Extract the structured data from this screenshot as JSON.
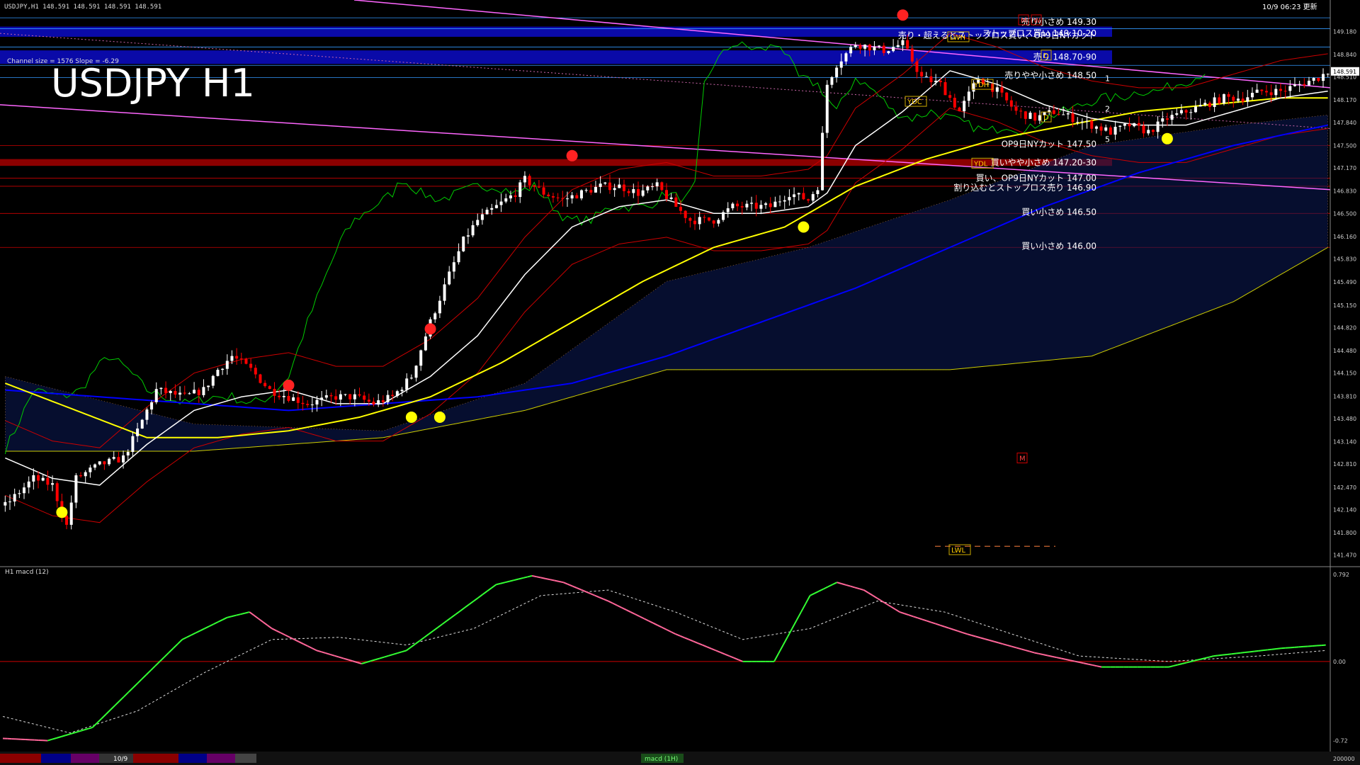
{
  "header": {
    "symbol_line": "USDJPY,H1  148.591 148.591 148.591 148.591",
    "channel_info": "Channel size = 1576 Slope = -6.29",
    "big_title": "USDJPY H1",
    "datetime": "10/9 06:23 更新"
  },
  "price_axis": {
    "labels": [
      "149.180",
      "148.840",
      "148.510",
      "148.170",
      "147.840",
      "147.500",
      "147.170",
      "146.830",
      "146.500",
      "146.160",
      "145.830",
      "145.490",
      "145.150",
      "144.820",
      "144.480",
      "144.150",
      "143.810",
      "143.480",
      "143.140",
      "142.810",
      "142.470",
      "142.140",
      "141.800",
      "141.470"
    ],
    "current": "148.591"
  },
  "annotations": [
    {
      "text": "売り小さめ 149.30",
      "price": 149.32,
      "color": "#ffffff"
    },
    {
      "text": "ストップロス買い 149.10-20",
      "price": 149.15,
      "color": "#ffffff"
    },
    {
      "text": "売り・超えるとストップロス買い、OP9日NYカット",
      "price": 149.12,
      "color": "#ffffff"
    },
    {
      "text": "売り 148.70-90",
      "price": 148.8,
      "color": "#ffffff"
    },
    {
      "text": "売りやや小さめ 148.50",
      "price": 148.53,
      "color": "#ffffff"
    },
    {
      "text": "OP9日NYカット 147.50",
      "price": 147.52,
      "color": "#ffffff"
    },
    {
      "text": "買いやや小さめ 147.20-30",
      "price": 147.25,
      "color": "#ffffff"
    },
    {
      "text": "買い、OP9日NYカット 147.00",
      "price": 147.02,
      "color": "#ffffff"
    },
    {
      "text": "割り込むとストップロス売り 146.90",
      "price": 146.88,
      "color": "#ffffff"
    },
    {
      "text": "買い小さめ 146.50",
      "price": 146.52,
      "color": "#ffffff"
    },
    {
      "text": "買い小さめ 146.00",
      "price": 146.02,
      "color": "#ffffff"
    }
  ],
  "level_tags": [
    {
      "text": "YDH",
      "price": 148.4
    },
    {
      "text": "YDC",
      "price": 148.15
    },
    {
      "text": "YDL",
      "price": 147.24
    },
    {
      "text": "LWH",
      "price": 149.1
    },
    {
      "text": "LWL",
      "price": 141.55
    },
    {
      "text": "D",
      "price": 148.83
    },
    {
      "text": "D",
      "price": 147.92
    },
    {
      "text": "M",
      "price": 149.35
    },
    {
      "text": "W",
      "price": 149.35
    },
    {
      "text": "M",
      "price": 142.9
    }
  ],
  "wave_labels": [
    "1",
    "2",
    "5"
  ],
  "macd": {
    "label": "H1  macd (12)",
    "axis_labels": [
      "0.792",
      "0.00",
      "-0.72"
    ]
  },
  "bottom_bar": {
    "date_tab": "10/9",
    "indicator_tab": "macd (1H)",
    "volume_label": "200000"
  },
  "colors": {
    "bull": "#ffffff",
    "bear": "#ff0000",
    "ma_white": "#ffffff",
    "ma_yellow": "#ffff00",
    "ma_blue": "#0000ff",
    "chikou": "#00cc00",
    "bollinger": "#cc0000",
    "channel": "#ff66ff",
    "macd_up": "#33ff33",
    "macd_down": "#ff6699",
    "signal": "#dddddd"
  },
  "chart_data": [
    {
      "type": "candlestick",
      "title": "USDJPY H1",
      "ylim": [
        141.3,
        149.6
      ],
      "y_ticks": [
        149.18,
        148.84,
        148.51,
        148.17,
        147.84,
        147.5,
        147.17,
        146.83,
        146.5,
        146.16,
        145.83,
        145.49,
        145.15,
        144.82,
        144.48,
        144.15,
        143.81,
        143.48,
        143.14,
        142.81,
        142.47,
        142.14,
        141.8,
        141.47
      ],
      "path_keys": [
        [
          0,
          142.2
        ],
        [
          6,
          142.6
        ],
        [
          10,
          142.5
        ],
        [
          13,
          141.9
        ],
        [
          15,
          142.6
        ],
        [
          20,
          142.8
        ],
        [
          25,
          142.9
        ],
        [
          28,
          143.3
        ],
        [
          32,
          143.9
        ],
        [
          38,
          143.8
        ],
        [
          42,
          143.9
        ],
        [
          45,
          144.2
        ],
        [
          48,
          144.4
        ],
        [
          52,
          144.2
        ],
        [
          56,
          143.9
        ],
        [
          60,
          143.8
        ],
        [
          64,
          143.7
        ],
        [
          70,
          143.8
        ],
        [
          74,
          143.8
        ],
        [
          78,
          143.7
        ],
        [
          82,
          143.8
        ],
        [
          86,
          144.1
        ],
        [
          90,
          144.9
        ],
        [
          94,
          145.6
        ],
        [
          97,
          146.1
        ],
        [
          100,
          146.4
        ],
        [
          104,
          146.6
        ],
        [
          108,
          146.8
        ],
        [
          110,
          147.0
        ],
        [
          114,
          146.8
        ],
        [
          118,
          146.7
        ],
        [
          122,
          146.8
        ],
        [
          126,
          146.9
        ],
        [
          130,
          146.9
        ],
        [
          134,
          146.8
        ],
        [
          138,
          146.9
        ],
        [
          142,
          146.6
        ],
        [
          145,
          146.4
        ],
        [
          150,
          146.4
        ],
        [
          154,
          146.6
        ],
        [
          158,
          146.6
        ],
        [
          162,
          146.6
        ],
        [
          166,
          146.8
        ],
        [
          170,
          146.7
        ],
        [
          172,
          146.9
        ],
        [
          174,
          148.4
        ],
        [
          176,
          148.7
        ],
        [
          180,
          149.0
        ],
        [
          186,
          148.9
        ],
        [
          190,
          149.0
        ],
        [
          194,
          148.5
        ],
        [
          198,
          148.4
        ],
        [
          202,
          148.0
        ],
        [
          206,
          148.5
        ],
        [
          210,
          148.3
        ],
        [
          214,
          148.0
        ],
        [
          218,
          147.9
        ],
        [
          222,
          148.0
        ],
        [
          226,
          147.9
        ],
        [
          230,
          147.8
        ],
        [
          234,
          147.7
        ],
        [
          238,
          147.8
        ],
        [
          242,
          147.7
        ],
        [
          246,
          147.9
        ],
        [
          250,
          148.0
        ],
        [
          254,
          148.1
        ],
        [
          258,
          148.2
        ],
        [
          262,
          148.2
        ],
        [
          266,
          148.3
        ],
        [
          270,
          148.3
        ],
        [
          274,
          148.4
        ],
        [
          278,
          148.5
        ],
        [
          280,
          148.59
        ]
      ],
      "ma_white_keys": [
        [
          0,
          142.9
        ],
        [
          10,
          142.6
        ],
        [
          20,
          142.5
        ],
        [
          30,
          143.1
        ],
        [
          40,
          143.6
        ],
        [
          50,
          143.8
        ],
        [
          60,
          143.9
        ],
        [
          70,
          143.7
        ],
        [
          80,
          143.7
        ],
        [
          90,
          144.1
        ],
        [
          100,
          144.7
        ],
        [
          110,
          145.6
        ],
        [
          120,
          146.3
        ],
        [
          130,
          146.6
        ],
        [
          140,
          146.7
        ],
        [
          150,
          146.5
        ],
        [
          160,
          146.5
        ],
        [
          170,
          146.6
        ],
        [
          174,
          146.8
        ],
        [
          180,
          147.5
        ],
        [
          190,
          148.0
        ],
        [
          200,
          148.6
        ],
        [
          210,
          148.4
        ],
        [
          220,
          148.1
        ],
        [
          230,
          147.9
        ],
        [
          240,
          147.8
        ],
        [
          250,
          147.8
        ],
        [
          260,
          148.0
        ],
        [
          270,
          148.2
        ],
        [
          280,
          148.3
        ]
      ],
      "ma_yellow_keys": [
        [
          0,
          144.0
        ],
        [
          15,
          143.6
        ],
        [
          30,
          143.2
        ],
        [
          45,
          143.2
        ],
        [
          60,
          143.3
        ],
        [
          75,
          143.5
        ],
        [
          90,
          143.8
        ],
        [
          105,
          144.3
        ],
        [
          120,
          144.9
        ],
        [
          135,
          145.5
        ],
        [
          150,
          146.0
        ],
        [
          165,
          146.3
        ],
        [
          180,
          146.9
        ],
        [
          195,
          147.3
        ],
        [
          210,
          147.6
        ],
        [
          225,
          147.8
        ],
        [
          240,
          148.0
        ],
        [
          255,
          148.1
        ],
        [
          270,
          148.2
        ],
        [
          280,
          148.2
        ]
      ],
      "ma_blue_keys": [
        [
          0,
          143.9
        ],
        [
          20,
          143.8
        ],
        [
          40,
          143.7
        ],
        [
          60,
          143.6
        ],
        [
          80,
          143.7
        ],
        [
          100,
          143.8
        ],
        [
          120,
          144.0
        ],
        [
          140,
          144.4
        ],
        [
          160,
          144.9
        ],
        [
          180,
          145.4
        ],
        [
          200,
          146.0
        ],
        [
          220,
          146.6
        ],
        [
          240,
          147.1
        ],
        [
          260,
          147.5
        ],
        [
          280,
          147.8
        ]
      ],
      "macd": {
        "ylim": [
          -0.8,
          0.85
        ],
        "keys": [
          [
            0,
            -0.7
          ],
          [
            10,
            -0.72
          ],
          [
            20,
            -0.6
          ],
          [
            30,
            -0.2
          ],
          [
            40,
            0.2
          ],
          [
            50,
            0.4
          ],
          [
            55,
            0.45
          ],
          [
            60,
            0.3
          ],
          [
            70,
            0.1
          ],
          [
            80,
            -0.02
          ],
          [
            90,
            0.1
          ],
          [
            100,
            0.4
          ],
          [
            110,
            0.7
          ],
          [
            118,
            0.78
          ],
          [
            125,
            0.72
          ],
          [
            135,
            0.55
          ],
          [
            150,
            0.25
          ],
          [
            165,
            0.0
          ],
          [
            172,
            0.0
          ],
          [
            180,
            0.6
          ],
          [
            186,
            0.72
          ],
          [
            192,
            0.65
          ],
          [
            200,
            0.45
          ],
          [
            215,
            0.25
          ],
          [
            230,
            0.08
          ],
          [
            245,
            -0.05
          ],
          [
            260,
            -0.05
          ],
          [
            270,
            0.05
          ],
          [
            285,
            0.12
          ],
          [
            295,
            0.15
          ]
        ],
        "signal_keys": [
          [
            0,
            -0.5
          ],
          [
            15,
            -0.65
          ],
          [
            30,
            -0.45
          ],
          [
            45,
            -0.1
          ],
          [
            60,
            0.2
          ],
          [
            75,
            0.22
          ],
          [
            90,
            0.15
          ],
          [
            105,
            0.3
          ],
          [
            120,
            0.6
          ],
          [
            135,
            0.65
          ],
          [
            150,
            0.45
          ],
          [
            165,
            0.2
          ],
          [
            180,
            0.3
          ],
          [
            195,
            0.55
          ],
          [
            210,
            0.45
          ],
          [
            225,
            0.25
          ],
          [
            240,
            0.05
          ],
          [
            260,
            0.0
          ],
          [
            280,
            0.05
          ],
          [
            295,
            0.1
          ]
        ]
      }
    }
  ]
}
